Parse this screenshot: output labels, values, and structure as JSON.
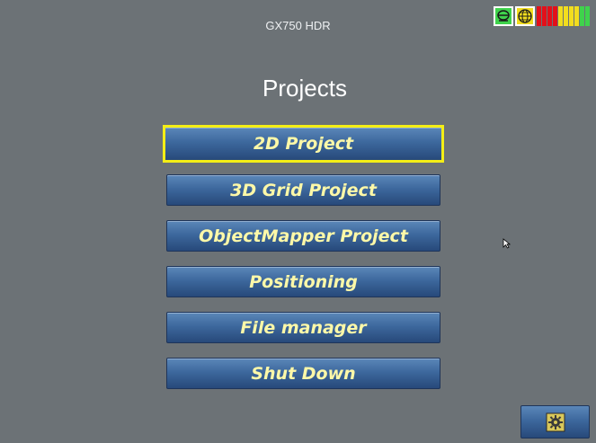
{
  "header": {
    "device_title": "GX750 HDR",
    "status_icons": [
      "gps-icon",
      "globe-icon",
      "signal-strength-icon"
    ]
  },
  "page": {
    "title": "Projects"
  },
  "menu": {
    "items": [
      {
        "label": "2D Project",
        "selected": true
      },
      {
        "label": "3D Grid Project",
        "selected": false
      },
      {
        "label": "ObjectMapper Project",
        "selected": false
      },
      {
        "label": "Positioning",
        "selected": false
      },
      {
        "label": "File manager",
        "selected": false
      },
      {
        "label": "Shut Down",
        "selected": false
      }
    ]
  },
  "footer": {
    "settings_icon": "gear-icon"
  },
  "colors": {
    "background": "#6c7276",
    "button_text": "#fdf8a8",
    "selection": "#f4ee16",
    "status_green": "#3fd34c",
    "status_yellow": "#f2dd1e",
    "signal_red": "#e3101a"
  }
}
